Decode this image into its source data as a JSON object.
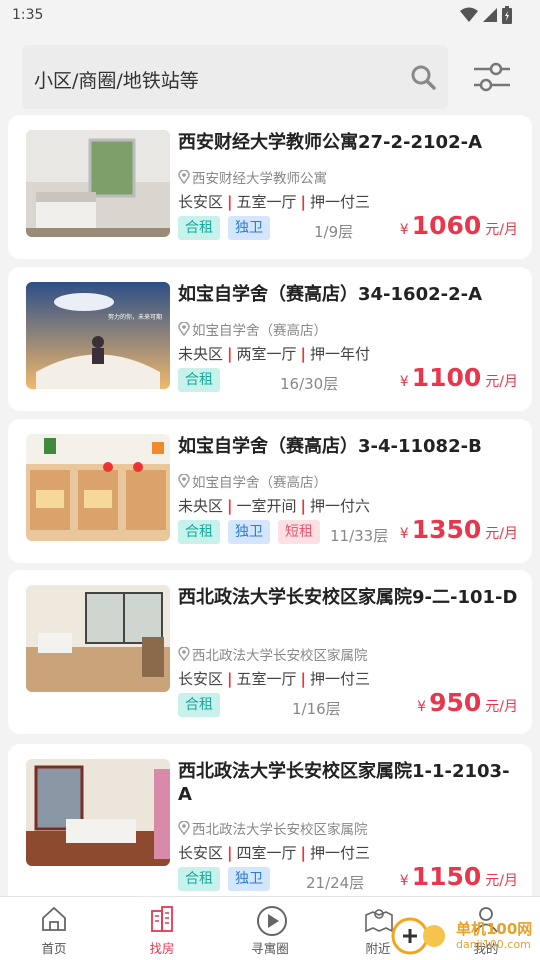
{
  "status": {
    "time": "1:35"
  },
  "search": {
    "placeholder": "小区/商圈/地铁站等"
  },
  "listings": [
    {
      "title": "西安财经大学教师公寓27-2-2102-A",
      "community": "西安财经大学教师公寓",
      "district": "长安区",
      "layout": "五室一厅",
      "payment": "押一付三",
      "tags": [
        "合租",
        "独卫"
      ],
      "floor": "1/9层",
      "price": "1060",
      "currency": "¥",
      "unit": "元/月"
    },
    {
      "title": "如宝自学舍（赛高店）34-1602-2-A",
      "community": "如宝自学舍（赛高店）",
      "district": "未央区",
      "layout": "两室一厅",
      "payment": "押一年付",
      "tags": [
        "合租"
      ],
      "floor": "16/30层",
      "price": "1100",
      "currency": "¥",
      "unit": "元/月"
    },
    {
      "title": "如宝自学舍（赛高店）3-4-11082-B",
      "community": "如宝自学舍（赛高店）",
      "district": "未央区",
      "layout": "一室开间",
      "payment": "押一付六",
      "tags": [
        "合租",
        "独卫",
        "短租"
      ],
      "floor": "11/33层",
      "price": "1350",
      "currency": "¥",
      "unit": "元/月"
    },
    {
      "title": "西北政法大学长安校区家属院9-二-101-D",
      "community": "西北政法大学长安校区家属院",
      "district": "长安区",
      "layout": "五室一厅",
      "payment": "押一付三",
      "tags": [
        "合租"
      ],
      "floor": "1/16层",
      "price": "950",
      "currency": "¥",
      "unit": "元/月"
    },
    {
      "title": "西北政法大学长安校区家属院1-1-2103-A",
      "community": "西北政法大学长安校区家属院",
      "district": "长安区",
      "layout": "四室一厅",
      "payment": "押一付三",
      "tags": [
        "合租",
        "独卫"
      ],
      "floor": "21/24层",
      "price": "1150",
      "currency": "¥",
      "unit": "元/月"
    }
  ],
  "photo_overlay": {
    "text": "努力的你，未来可期"
  },
  "tabs": [
    {
      "label": "首页",
      "icon": "home-icon"
    },
    {
      "label": "找房",
      "icon": "building-icon"
    },
    {
      "label": "寻寓圈",
      "icon": "circle-play-icon"
    },
    {
      "label": "附近",
      "icon": "map-pin-icon"
    },
    {
      "label": "我的",
      "icon": "user-icon"
    }
  ],
  "watermark": {
    "name": "单机100网",
    "url": "danji100.com"
  },
  "colors": {
    "accent": "#e8374d",
    "tag_green": "#17a99a",
    "tag_blue": "#2b7bd4",
    "tag_red": "#e2586b"
  }
}
